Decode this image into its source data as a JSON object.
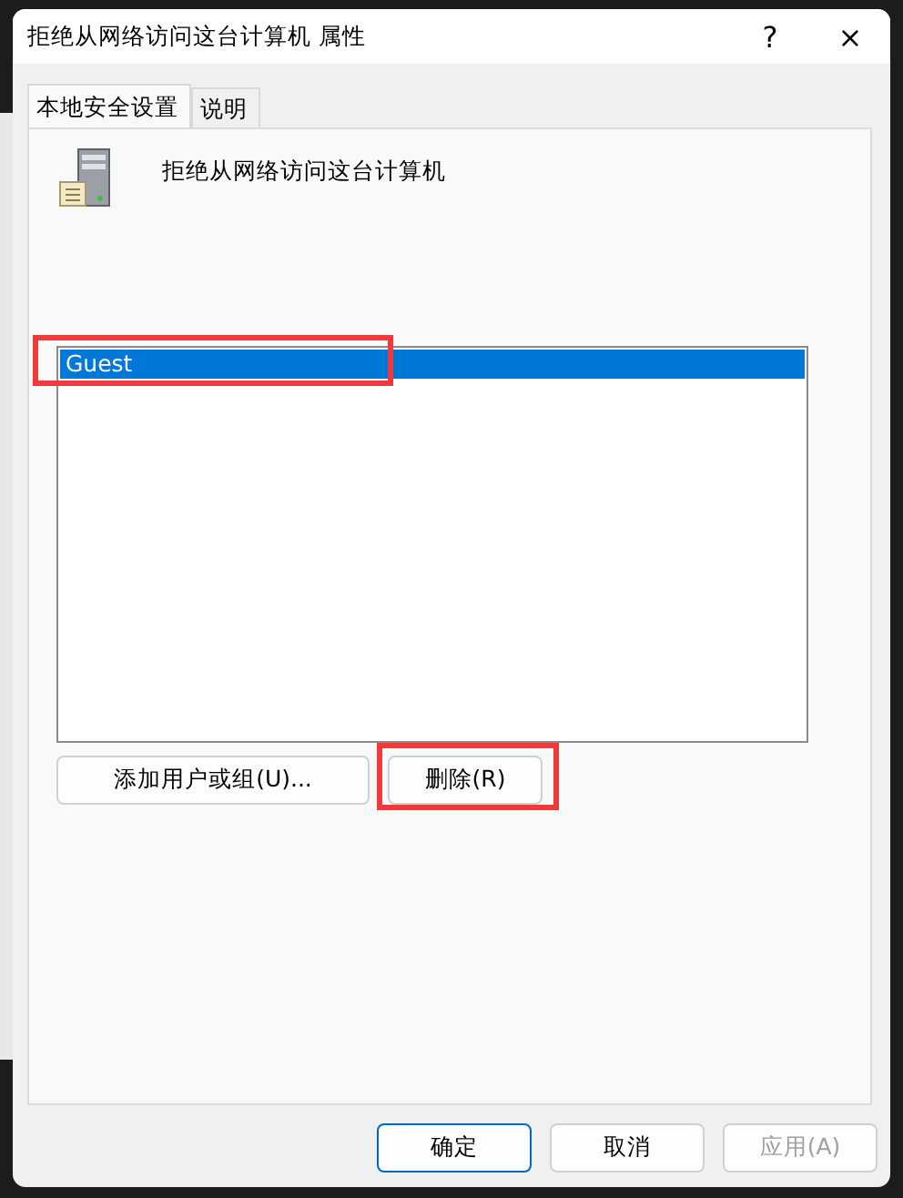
{
  "window": {
    "title": "拒绝从网络访问这台计算机 属性",
    "help": "?",
    "close": "×"
  },
  "tabs": [
    {
      "label": "本地安全设置",
      "selected": true
    },
    {
      "label": "说明",
      "selected": false
    }
  ],
  "policy": {
    "name": "拒绝从网络访问这台计算机"
  },
  "users": [
    {
      "name": "Guest",
      "selected": true
    }
  ],
  "actions": [
    {
      "label": "添加用户或组(U)...",
      "highlighted": false
    },
    {
      "label": "删除(R)",
      "highlighted": true
    }
  ],
  "user_list_highlighted": true,
  "buttons": [
    {
      "label": "确定",
      "default": true,
      "disabled": false
    },
    {
      "label": "取消",
      "default": false,
      "disabled": false
    },
    {
      "label": "应用(A)",
      "default": false,
      "disabled": true
    }
  ]
}
